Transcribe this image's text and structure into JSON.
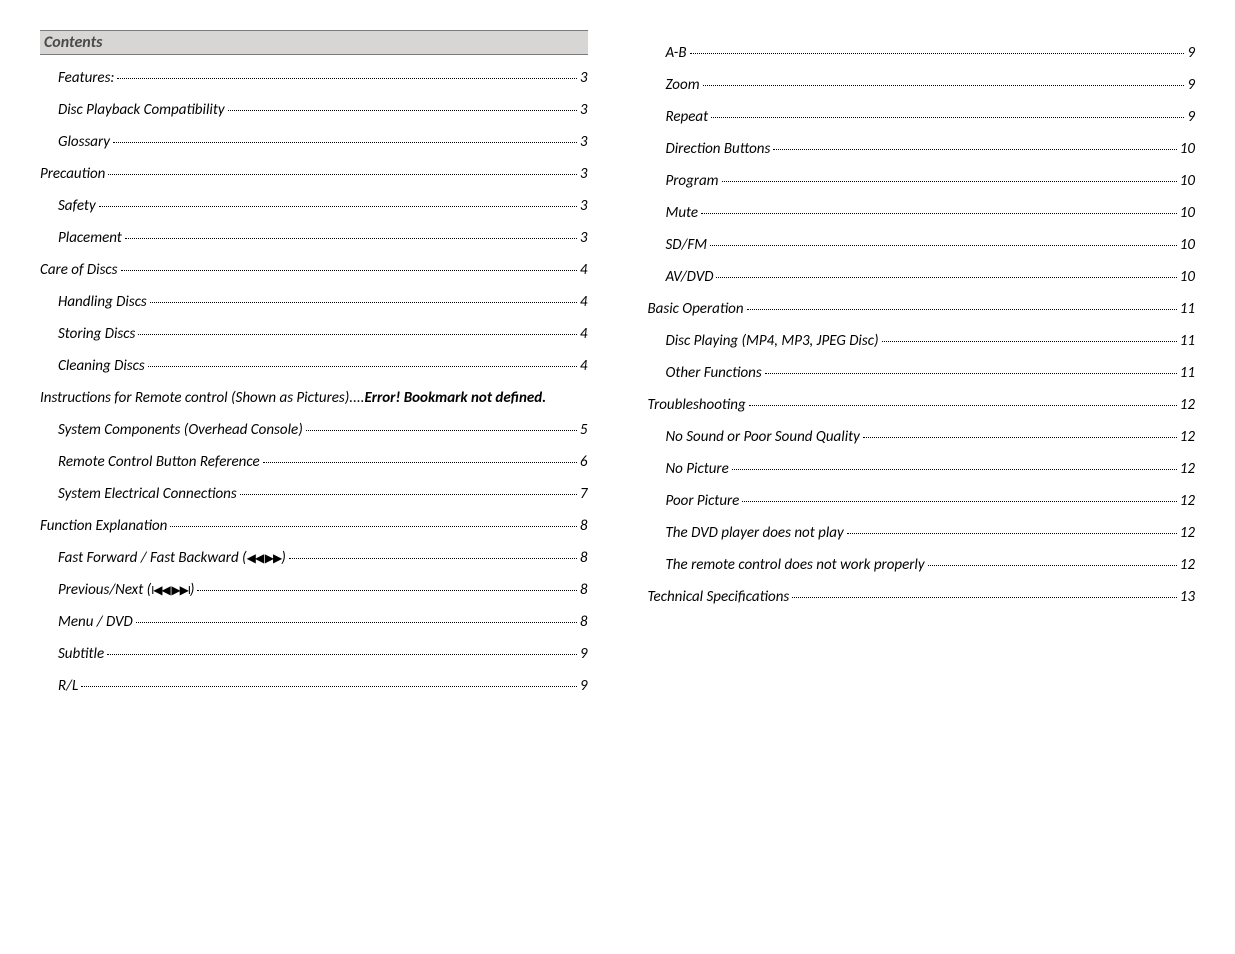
{
  "header": "Contents",
  "left": [
    {
      "lvl": 1,
      "title": "Features:",
      "page": "3"
    },
    {
      "lvl": 1,
      "title": "Disc Playback Compatibility",
      "page": "3"
    },
    {
      "lvl": 1,
      "title": "Glossary",
      "page": "3"
    },
    {
      "lvl": 0,
      "title": "Precaution",
      "page": "3"
    },
    {
      "lvl": 1,
      "title": "Safety",
      "page": "3"
    },
    {
      "lvl": 1,
      "title": "Placement",
      "page": "3"
    },
    {
      "lvl": 0,
      "title": "Care of Discs",
      "page": "4"
    },
    {
      "lvl": 1,
      "title": "Handling Discs",
      "page": "4"
    },
    {
      "lvl": 1,
      "title": "Storing Discs",
      "page": "4"
    },
    {
      "lvl": 1,
      "title": "Cleaning Discs",
      "page": "4"
    },
    {
      "lvl": 0,
      "title": "Instructions for Remote control (Shown as Pictures)",
      "page": "Error! Bookmark not defined.",
      "nodots": true,
      "pgbold": true
    },
    {
      "lvl": 1,
      "title": "System Components (Overhead Console)",
      "page": "5"
    },
    {
      "lvl": 1,
      "title": "Remote Control Button Reference",
      "page": "6"
    },
    {
      "lvl": 1,
      "title": "System Electrical Connections",
      "page": "7"
    },
    {
      "lvl": 0,
      "title": "Function Explanation",
      "page": "8"
    },
    {
      "lvl": 1,
      "title": "Fast Forward / Fast Backward (",
      "icons": "◀◀ ▶▶",
      "title2": ")",
      "page": "8"
    },
    {
      "lvl": 1,
      "title": "Previous/Next (",
      "icons": "I◀◀ ▶▶I",
      "title2": ")",
      "page": "8"
    },
    {
      "lvl": 1,
      "title": "Menu / DVD",
      "page": "8"
    },
    {
      "lvl": 1,
      "title": "Subtitle",
      "page": "9"
    },
    {
      "lvl": 1,
      "title": "R/L",
      "page": "9"
    }
  ],
  "right": [
    {
      "lvl": 1,
      "title": "A-B",
      "page": "9"
    },
    {
      "lvl": 1,
      "title": "Zoom",
      "page": "9"
    },
    {
      "lvl": 1,
      "title": "Repeat",
      "page": "9"
    },
    {
      "lvl": 1,
      "title": "Direction Buttons",
      "page": "10"
    },
    {
      "lvl": 1,
      "title": "Program",
      "page": "10"
    },
    {
      "lvl": 1,
      "title": "Mute",
      "page": "10"
    },
    {
      "lvl": 1,
      "title": "SD/FM",
      "page": "10"
    },
    {
      "lvl": 1,
      "title": "AV/DVD",
      "page": "10"
    },
    {
      "lvl": 0,
      "title": "Basic Operation",
      "page": "11"
    },
    {
      "lvl": 1,
      "title": "Disc Playing (MP4, MP3, JPEG Disc)",
      "page": "11"
    },
    {
      "lvl": 1,
      "title": "Other Functions",
      "page": "11"
    },
    {
      "lvl": 0,
      "title": "Troubleshooting",
      "page": "12"
    },
    {
      "lvl": 1,
      "title": "No Sound or Poor Sound Quality",
      "page": "12"
    },
    {
      "lvl": 1,
      "title": "No Picture",
      "page": "12"
    },
    {
      "lvl": 1,
      "title": "Poor Picture",
      "page": "12"
    },
    {
      "lvl": 1,
      "title": "The DVD player does not play",
      "page": "12"
    },
    {
      "lvl": 1,
      "title": "The remote control does not work properly",
      "page": "12"
    },
    {
      "lvl": 0,
      "title": "Technical Specifications",
      "page": "13"
    }
  ]
}
